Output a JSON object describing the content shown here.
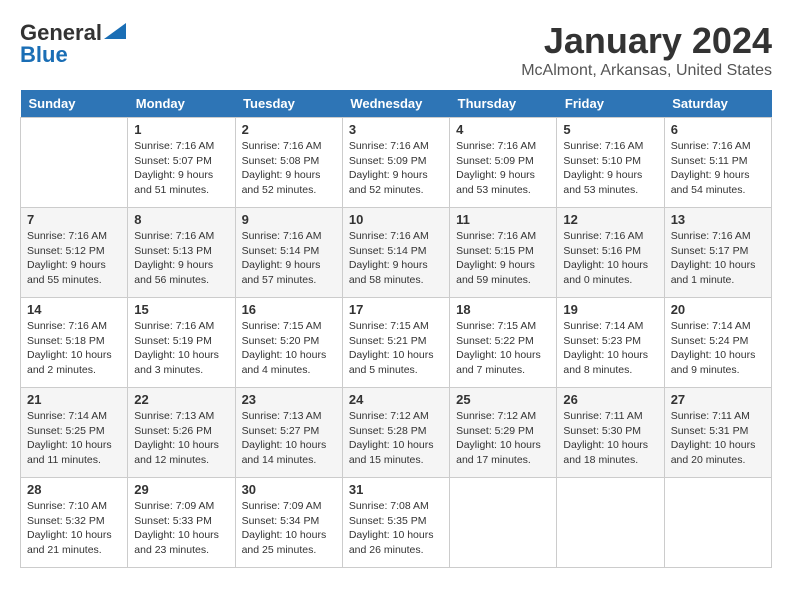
{
  "header": {
    "logo_line1": "General",
    "logo_line2": "Blue",
    "month": "January 2024",
    "location": "McAlmont, Arkansas, United States"
  },
  "weekdays": [
    "Sunday",
    "Monday",
    "Tuesday",
    "Wednesday",
    "Thursday",
    "Friday",
    "Saturday"
  ],
  "weeks": [
    [
      {
        "day": "",
        "sunrise": "",
        "sunset": "",
        "daylight": ""
      },
      {
        "day": "1",
        "sunrise": "Sunrise: 7:16 AM",
        "sunset": "Sunset: 5:07 PM",
        "daylight": "Daylight: 9 hours and 51 minutes."
      },
      {
        "day": "2",
        "sunrise": "Sunrise: 7:16 AM",
        "sunset": "Sunset: 5:08 PM",
        "daylight": "Daylight: 9 hours and 52 minutes."
      },
      {
        "day": "3",
        "sunrise": "Sunrise: 7:16 AM",
        "sunset": "Sunset: 5:09 PM",
        "daylight": "Daylight: 9 hours and 52 minutes."
      },
      {
        "day": "4",
        "sunrise": "Sunrise: 7:16 AM",
        "sunset": "Sunset: 5:09 PM",
        "daylight": "Daylight: 9 hours and 53 minutes."
      },
      {
        "day": "5",
        "sunrise": "Sunrise: 7:16 AM",
        "sunset": "Sunset: 5:10 PM",
        "daylight": "Daylight: 9 hours and 53 minutes."
      },
      {
        "day": "6",
        "sunrise": "Sunrise: 7:16 AM",
        "sunset": "Sunset: 5:11 PM",
        "daylight": "Daylight: 9 hours and 54 minutes."
      }
    ],
    [
      {
        "day": "7",
        "sunrise": "Sunrise: 7:16 AM",
        "sunset": "Sunset: 5:12 PM",
        "daylight": "Daylight: 9 hours and 55 minutes."
      },
      {
        "day": "8",
        "sunrise": "Sunrise: 7:16 AM",
        "sunset": "Sunset: 5:13 PM",
        "daylight": "Daylight: 9 hours and 56 minutes."
      },
      {
        "day": "9",
        "sunrise": "Sunrise: 7:16 AM",
        "sunset": "Sunset: 5:14 PM",
        "daylight": "Daylight: 9 hours and 57 minutes."
      },
      {
        "day": "10",
        "sunrise": "Sunrise: 7:16 AM",
        "sunset": "Sunset: 5:14 PM",
        "daylight": "Daylight: 9 hours and 58 minutes."
      },
      {
        "day": "11",
        "sunrise": "Sunrise: 7:16 AM",
        "sunset": "Sunset: 5:15 PM",
        "daylight": "Daylight: 9 hours and 59 minutes."
      },
      {
        "day": "12",
        "sunrise": "Sunrise: 7:16 AM",
        "sunset": "Sunset: 5:16 PM",
        "daylight": "Daylight: 10 hours and 0 minutes."
      },
      {
        "day": "13",
        "sunrise": "Sunrise: 7:16 AM",
        "sunset": "Sunset: 5:17 PM",
        "daylight": "Daylight: 10 hours and 1 minute."
      }
    ],
    [
      {
        "day": "14",
        "sunrise": "Sunrise: 7:16 AM",
        "sunset": "Sunset: 5:18 PM",
        "daylight": "Daylight: 10 hours and 2 minutes."
      },
      {
        "day": "15",
        "sunrise": "Sunrise: 7:16 AM",
        "sunset": "Sunset: 5:19 PM",
        "daylight": "Daylight: 10 hours and 3 minutes."
      },
      {
        "day": "16",
        "sunrise": "Sunrise: 7:15 AM",
        "sunset": "Sunset: 5:20 PM",
        "daylight": "Daylight: 10 hours and 4 minutes."
      },
      {
        "day": "17",
        "sunrise": "Sunrise: 7:15 AM",
        "sunset": "Sunset: 5:21 PM",
        "daylight": "Daylight: 10 hours and 5 minutes."
      },
      {
        "day": "18",
        "sunrise": "Sunrise: 7:15 AM",
        "sunset": "Sunset: 5:22 PM",
        "daylight": "Daylight: 10 hours and 7 minutes."
      },
      {
        "day": "19",
        "sunrise": "Sunrise: 7:14 AM",
        "sunset": "Sunset: 5:23 PM",
        "daylight": "Daylight: 10 hours and 8 minutes."
      },
      {
        "day": "20",
        "sunrise": "Sunrise: 7:14 AM",
        "sunset": "Sunset: 5:24 PM",
        "daylight": "Daylight: 10 hours and 9 minutes."
      }
    ],
    [
      {
        "day": "21",
        "sunrise": "Sunrise: 7:14 AM",
        "sunset": "Sunset: 5:25 PM",
        "daylight": "Daylight: 10 hours and 11 minutes."
      },
      {
        "day": "22",
        "sunrise": "Sunrise: 7:13 AM",
        "sunset": "Sunset: 5:26 PM",
        "daylight": "Daylight: 10 hours and 12 minutes."
      },
      {
        "day": "23",
        "sunrise": "Sunrise: 7:13 AM",
        "sunset": "Sunset: 5:27 PM",
        "daylight": "Daylight: 10 hours and 14 minutes."
      },
      {
        "day": "24",
        "sunrise": "Sunrise: 7:12 AM",
        "sunset": "Sunset: 5:28 PM",
        "daylight": "Daylight: 10 hours and 15 minutes."
      },
      {
        "day": "25",
        "sunrise": "Sunrise: 7:12 AM",
        "sunset": "Sunset: 5:29 PM",
        "daylight": "Daylight: 10 hours and 17 minutes."
      },
      {
        "day": "26",
        "sunrise": "Sunrise: 7:11 AM",
        "sunset": "Sunset: 5:30 PM",
        "daylight": "Daylight: 10 hours and 18 minutes."
      },
      {
        "day": "27",
        "sunrise": "Sunrise: 7:11 AM",
        "sunset": "Sunset: 5:31 PM",
        "daylight": "Daylight: 10 hours and 20 minutes."
      }
    ],
    [
      {
        "day": "28",
        "sunrise": "Sunrise: 7:10 AM",
        "sunset": "Sunset: 5:32 PM",
        "daylight": "Daylight: 10 hours and 21 minutes."
      },
      {
        "day": "29",
        "sunrise": "Sunrise: 7:09 AM",
        "sunset": "Sunset: 5:33 PM",
        "daylight": "Daylight: 10 hours and 23 minutes."
      },
      {
        "day": "30",
        "sunrise": "Sunrise: 7:09 AM",
        "sunset": "Sunset: 5:34 PM",
        "daylight": "Daylight: 10 hours and 25 minutes."
      },
      {
        "day": "31",
        "sunrise": "Sunrise: 7:08 AM",
        "sunset": "Sunset: 5:35 PM",
        "daylight": "Daylight: 10 hours and 26 minutes."
      },
      {
        "day": "",
        "sunrise": "",
        "sunset": "",
        "daylight": ""
      },
      {
        "day": "",
        "sunrise": "",
        "sunset": "",
        "daylight": ""
      },
      {
        "day": "",
        "sunrise": "",
        "sunset": "",
        "daylight": ""
      }
    ]
  ]
}
